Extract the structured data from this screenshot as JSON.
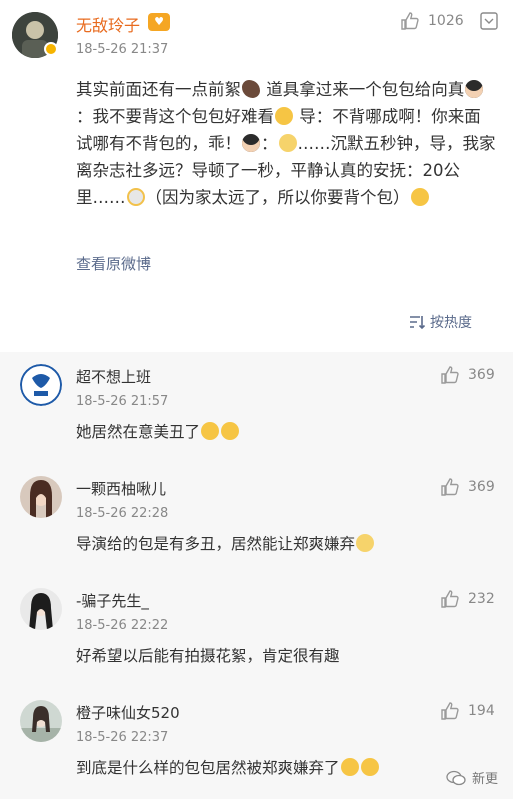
{
  "post": {
    "username": "无敌玲子",
    "time": "18-5-26 21:37",
    "likes": "1026",
    "text_segments": [
      "其实前面还有一点前絮",
      " 道具拿过来一个包包给向真",
      "：我不要背这个包包好难看",
      " 导：不背哪成啊！你来面试哪有不背包的，乖！",
      "：",
      "……沉默五秒钟，导，我家离杂志社多远？导顿了一秒，平静认真的安抚：20公里……",
      "（因为家太远了，所以你要背个包）"
    ],
    "view_original": "查看原微博",
    "sort_label": "按热度"
  },
  "comments": [
    {
      "name": "超不想上班",
      "time": "18-5-26 21:57",
      "text": "她居然在意美丑了",
      "likes": "369"
    },
    {
      "name": "一颗西柚啾儿",
      "time": "18-5-26 22:28",
      "text": "导演给的包是有多丑，居然能让郑爽嫌弃",
      "likes": "369"
    },
    {
      "name": "-骗子先生_",
      "time": "18-5-26 22:22",
      "text": "好希望以后能有拍摄花絮，肯定很有趣",
      "likes": "232"
    },
    {
      "name": "橙子味仙女520",
      "time": "18-5-26 22:37",
      "text": "到底是什么样的包包居然被郑爽嫌弃了",
      "likes": "194"
    }
  ],
  "watermark": {
    "label": "新更"
  },
  "icons": {
    "like": "thumbs-up-icon",
    "menu": "chevron-down-box-icon",
    "sort": "sort-icon",
    "verify": "verified-badge-icon",
    "watermark": "wechat-icon"
  },
  "colors": {
    "username": "#e86b1f",
    "link": "#5b6b8c",
    "comments_bg": "#f7f7f7",
    "muted": "#888888"
  }
}
